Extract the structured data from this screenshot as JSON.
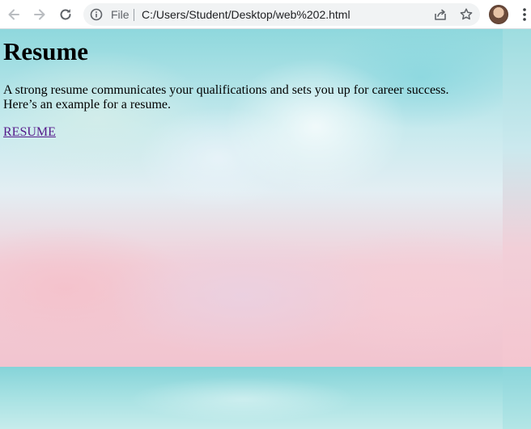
{
  "browser": {
    "address_scheme_label": "File",
    "address_url": "C:/Users/Student/Desktop/web%202.html",
    "icons": {
      "back": "back-arrow-icon",
      "forward": "forward-arrow-icon",
      "reload": "reload-icon",
      "site_info": "info-icon",
      "share": "share-icon",
      "bookmark": "star-icon",
      "profile": "avatar",
      "menu": "kebab-menu-icon"
    }
  },
  "page": {
    "heading": "Resume",
    "description_line1": "A strong resume communicates your qualifications and sets you up for career success.",
    "description_line2": "Here’s an example for a resume.",
    "link_text": "RESUME",
    "colors": {
      "link_visited": "#551a8b",
      "text": "#000000"
    }
  }
}
